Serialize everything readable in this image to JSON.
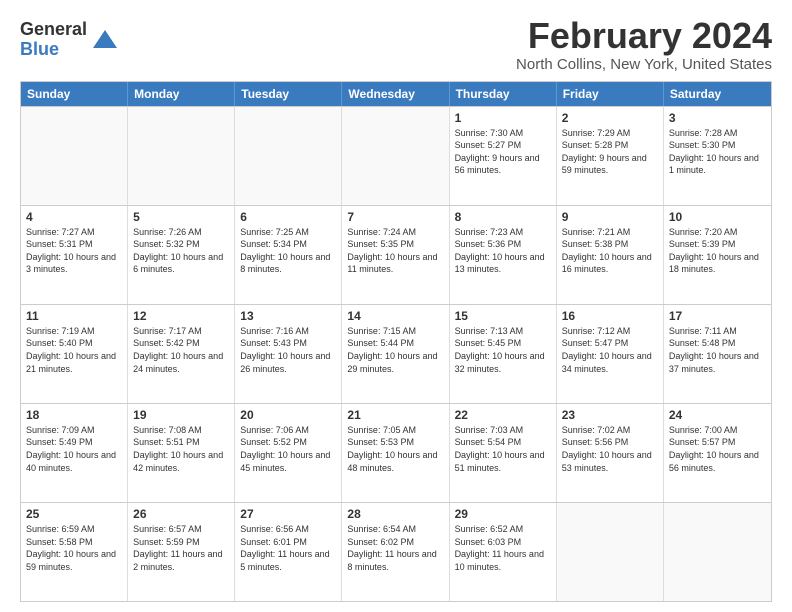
{
  "header": {
    "logo_general": "General",
    "logo_blue": "Blue",
    "month_title": "February 2024",
    "location": "North Collins, New York, United States"
  },
  "days_of_week": [
    "Sunday",
    "Monday",
    "Tuesday",
    "Wednesday",
    "Thursday",
    "Friday",
    "Saturday"
  ],
  "rows": [
    [
      {
        "day": "",
        "empty": true
      },
      {
        "day": "",
        "empty": true
      },
      {
        "day": "",
        "empty": true
      },
      {
        "day": "",
        "empty": true
      },
      {
        "day": "1",
        "sunrise": "Sunrise: 7:30 AM",
        "sunset": "Sunset: 5:27 PM",
        "daylight": "Daylight: 9 hours and 56 minutes."
      },
      {
        "day": "2",
        "sunrise": "Sunrise: 7:29 AM",
        "sunset": "Sunset: 5:28 PM",
        "daylight": "Daylight: 9 hours and 59 minutes."
      },
      {
        "day": "3",
        "sunrise": "Sunrise: 7:28 AM",
        "sunset": "Sunset: 5:30 PM",
        "daylight": "Daylight: 10 hours and 1 minute."
      }
    ],
    [
      {
        "day": "4",
        "sunrise": "Sunrise: 7:27 AM",
        "sunset": "Sunset: 5:31 PM",
        "daylight": "Daylight: 10 hours and 3 minutes."
      },
      {
        "day": "5",
        "sunrise": "Sunrise: 7:26 AM",
        "sunset": "Sunset: 5:32 PM",
        "daylight": "Daylight: 10 hours and 6 minutes."
      },
      {
        "day": "6",
        "sunrise": "Sunrise: 7:25 AM",
        "sunset": "Sunset: 5:34 PM",
        "daylight": "Daylight: 10 hours and 8 minutes."
      },
      {
        "day": "7",
        "sunrise": "Sunrise: 7:24 AM",
        "sunset": "Sunset: 5:35 PM",
        "daylight": "Daylight: 10 hours and 11 minutes."
      },
      {
        "day": "8",
        "sunrise": "Sunrise: 7:23 AM",
        "sunset": "Sunset: 5:36 PM",
        "daylight": "Daylight: 10 hours and 13 minutes."
      },
      {
        "day": "9",
        "sunrise": "Sunrise: 7:21 AM",
        "sunset": "Sunset: 5:38 PM",
        "daylight": "Daylight: 10 hours and 16 minutes."
      },
      {
        "day": "10",
        "sunrise": "Sunrise: 7:20 AM",
        "sunset": "Sunset: 5:39 PM",
        "daylight": "Daylight: 10 hours and 18 minutes."
      }
    ],
    [
      {
        "day": "11",
        "sunrise": "Sunrise: 7:19 AM",
        "sunset": "Sunset: 5:40 PM",
        "daylight": "Daylight: 10 hours and 21 minutes."
      },
      {
        "day": "12",
        "sunrise": "Sunrise: 7:17 AM",
        "sunset": "Sunset: 5:42 PM",
        "daylight": "Daylight: 10 hours and 24 minutes."
      },
      {
        "day": "13",
        "sunrise": "Sunrise: 7:16 AM",
        "sunset": "Sunset: 5:43 PM",
        "daylight": "Daylight: 10 hours and 26 minutes."
      },
      {
        "day": "14",
        "sunrise": "Sunrise: 7:15 AM",
        "sunset": "Sunset: 5:44 PM",
        "daylight": "Daylight: 10 hours and 29 minutes."
      },
      {
        "day": "15",
        "sunrise": "Sunrise: 7:13 AM",
        "sunset": "Sunset: 5:45 PM",
        "daylight": "Daylight: 10 hours and 32 minutes."
      },
      {
        "day": "16",
        "sunrise": "Sunrise: 7:12 AM",
        "sunset": "Sunset: 5:47 PM",
        "daylight": "Daylight: 10 hours and 34 minutes."
      },
      {
        "day": "17",
        "sunrise": "Sunrise: 7:11 AM",
        "sunset": "Sunset: 5:48 PM",
        "daylight": "Daylight: 10 hours and 37 minutes."
      }
    ],
    [
      {
        "day": "18",
        "sunrise": "Sunrise: 7:09 AM",
        "sunset": "Sunset: 5:49 PM",
        "daylight": "Daylight: 10 hours and 40 minutes."
      },
      {
        "day": "19",
        "sunrise": "Sunrise: 7:08 AM",
        "sunset": "Sunset: 5:51 PM",
        "daylight": "Daylight: 10 hours and 42 minutes."
      },
      {
        "day": "20",
        "sunrise": "Sunrise: 7:06 AM",
        "sunset": "Sunset: 5:52 PM",
        "daylight": "Daylight: 10 hours and 45 minutes."
      },
      {
        "day": "21",
        "sunrise": "Sunrise: 7:05 AM",
        "sunset": "Sunset: 5:53 PM",
        "daylight": "Daylight: 10 hours and 48 minutes."
      },
      {
        "day": "22",
        "sunrise": "Sunrise: 7:03 AM",
        "sunset": "Sunset: 5:54 PM",
        "daylight": "Daylight: 10 hours and 51 minutes."
      },
      {
        "day": "23",
        "sunrise": "Sunrise: 7:02 AM",
        "sunset": "Sunset: 5:56 PM",
        "daylight": "Daylight: 10 hours and 53 minutes."
      },
      {
        "day": "24",
        "sunrise": "Sunrise: 7:00 AM",
        "sunset": "Sunset: 5:57 PM",
        "daylight": "Daylight: 10 hours and 56 minutes."
      }
    ],
    [
      {
        "day": "25",
        "sunrise": "Sunrise: 6:59 AM",
        "sunset": "Sunset: 5:58 PM",
        "daylight": "Daylight: 10 hours and 59 minutes."
      },
      {
        "day": "26",
        "sunrise": "Sunrise: 6:57 AM",
        "sunset": "Sunset: 5:59 PM",
        "daylight": "Daylight: 11 hours and 2 minutes."
      },
      {
        "day": "27",
        "sunrise": "Sunrise: 6:56 AM",
        "sunset": "Sunset: 6:01 PM",
        "daylight": "Daylight: 11 hours and 5 minutes."
      },
      {
        "day": "28",
        "sunrise": "Sunrise: 6:54 AM",
        "sunset": "Sunset: 6:02 PM",
        "daylight": "Daylight: 11 hours and 8 minutes."
      },
      {
        "day": "29",
        "sunrise": "Sunrise: 6:52 AM",
        "sunset": "Sunset: 6:03 PM",
        "daylight": "Daylight: 11 hours and 10 minutes."
      },
      {
        "day": "",
        "empty": true
      },
      {
        "day": "",
        "empty": true
      }
    ]
  ]
}
